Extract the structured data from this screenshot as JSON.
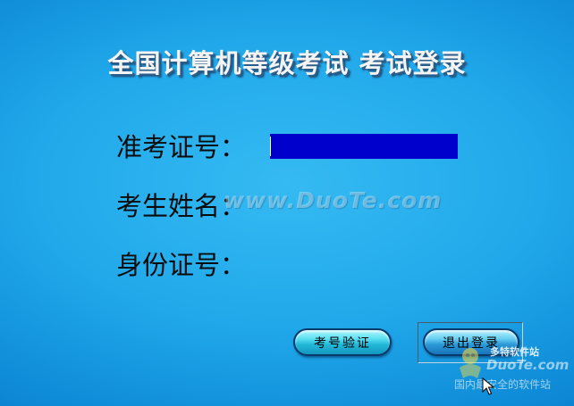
{
  "window": {
    "title": "全国计算机等级考试 考试登录"
  },
  "form": {
    "id_label": "准考证号：",
    "id_value": "",
    "name_label": "考生姓名：",
    "card_label": "身份证号："
  },
  "buttons": {
    "verify_label": "考号验证",
    "exit_label": "退出登录"
  },
  "watermark": {
    "center_text": "www.DuoTe.com",
    "logo_name": "多特软件站",
    "logo_brand": "DuoTe.com",
    "logo_tagline": "国内最安全的软件站"
  },
  "colors": {
    "background": "#1fa4e8",
    "input_fill": "#0000cc",
    "button_fill": "#4fd3ec"
  },
  "icons": {
    "cursor": "arrow-cursor-icon",
    "logo": "duote-logo-icon"
  }
}
